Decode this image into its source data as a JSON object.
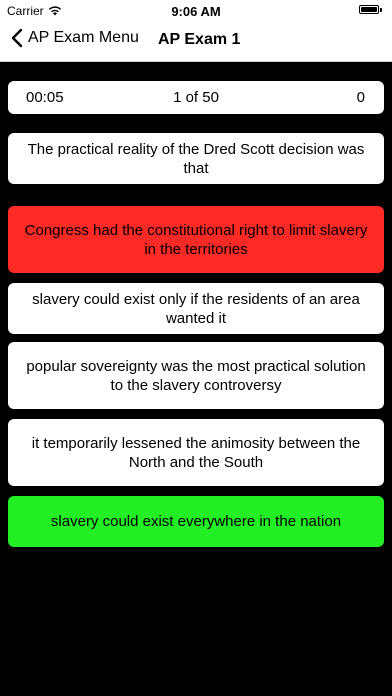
{
  "status_bar": {
    "carrier": "Carrier",
    "time": "9:06 AM",
    "wifi_icon": "wifi-icon",
    "battery_icon": "battery-icon"
  },
  "nav": {
    "back_label": "AP Exam Menu",
    "back_icon": "chevron-left-icon",
    "title": "AP Exam 1"
  },
  "stats": {
    "timer": "00:05",
    "progress": "1 of 50",
    "score": "0"
  },
  "question": "The practical reality of the Dred Scott decision was that",
  "answers": [
    {
      "text": "Congress had the constitutional right to limit slavery in the territories",
      "state": "incorrect",
      "color": "#ff2a25"
    },
    {
      "text": "slavery could exist only if the residents of an area wanted it",
      "state": "neutral",
      "color": "#ffffff"
    },
    {
      "text": "popular sovereignty was the most practical solution to the slavery controversy",
      "state": "neutral",
      "color": "#ffffff"
    },
    {
      "text": "it temporarily lessened the animosity between the North and the South",
      "state": "neutral",
      "color": "#ffffff"
    },
    {
      "text": "slavery could exist everywhere in the nation",
      "state": "correct",
      "color": "#22f025"
    }
  ],
  "colors": {
    "background": "#000000",
    "card": "#ffffff",
    "incorrect": "#ff2a25",
    "correct": "#22f025"
  }
}
